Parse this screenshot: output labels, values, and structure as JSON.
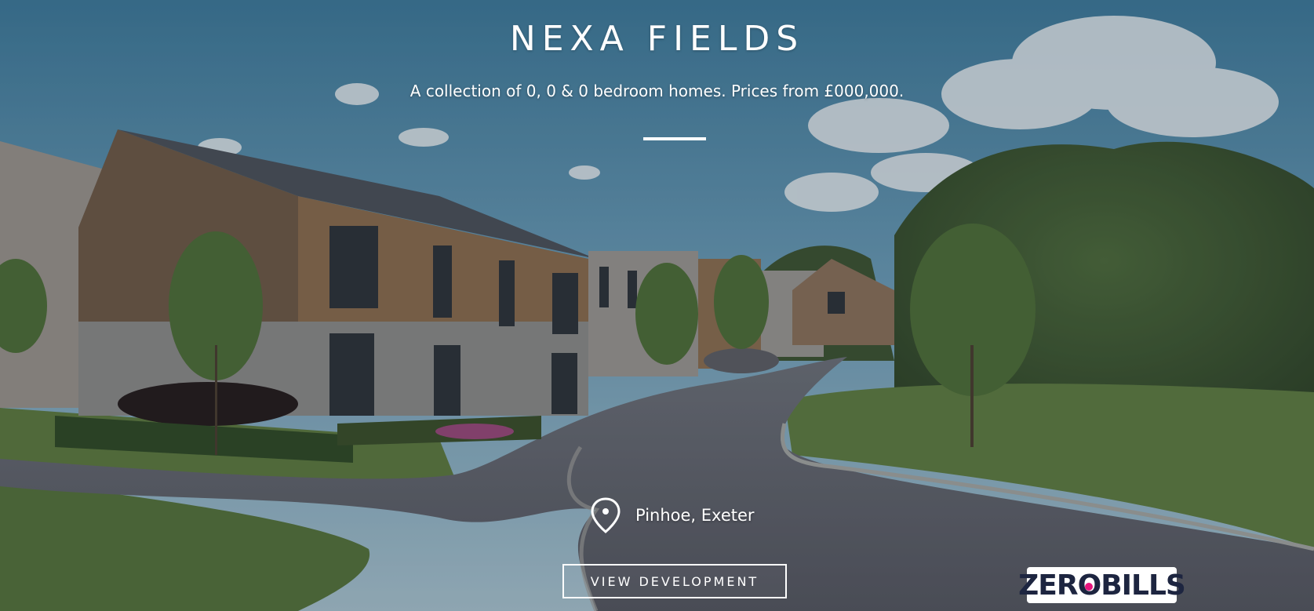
{
  "hero": {
    "title": "NEXA FIELDS",
    "subtitle": "A collection of 0, 0 & 0 bedroom homes. Prices from £000,000.",
    "location": "Pinhoe, Exeter",
    "cta_label": "VIEW DEVELOPMENT",
    "badge": {
      "part1": "ZER",
      "part2": "O",
      "part3": " BILLS",
      "accent": "#e6157d"
    },
    "icons": {
      "location": "map-pin-icon"
    }
  }
}
